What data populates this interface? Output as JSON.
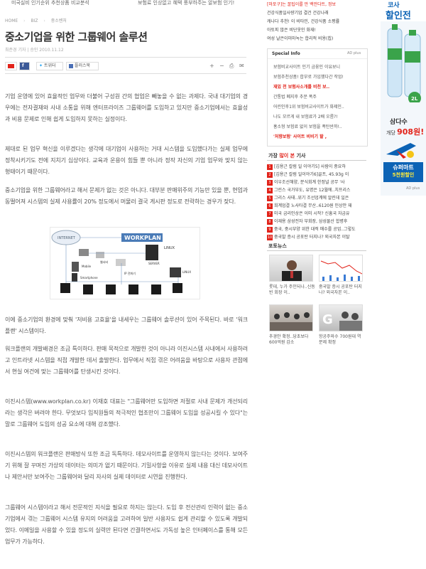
{
  "top_strip": {
    "left": "미국실비 인기순위 추천상품 비교분석",
    "right": "보험료 인상없고 혜택 풍부하주는 알보험 인기!"
  },
  "breadcrumb": [
    "HOME",
    "BIZ",
    "중소벤처"
  ],
  "article": {
    "title": "중소기업을 위한 그룹웨어 솔루션",
    "byline": "최준경 기자  |  승인 2010.11.12",
    "share": {
      "facebook": "",
      "twitter": "트위터",
      "story": "플러스북"
    },
    "controls": [
      "+",
      "−",
      "⎙",
      "✉"
    ],
    "paragraphs": [
      "기업 운영에 있어 효율적인 업무와 더불어 구성원 간의 협업은 빼놓을 수 없는 과제다. 국내 대기업의 경우에는 전자결재와 사내 소통을 위해 엔터프라이즈 그룹웨어를 도입하고 있지만 중소기업에서는 효율성과 비용 문제로 인해 쉽게 도입하지 못하는 실정이다.",
      "제대로 된 업무 혁신을 이루겠다는 생각에 대기업이 사용하는 거대 시스템을 도입했다가는 실제 업무에 정착시키기도 전에 지치기 십상이다. 교육과 운용이 힘들 뿐 아니라 정작 자신의 기업 업무와 맞지 않는 형태이기 때문이다.",
      "중소기업을 위한 그룹웨어라고 해서 문제가 없는 것은 아니다. 대부분 판매위주의 기능만 있을 뿐, 현업과 동떨어져 시스템의 실제 사용률이 20% 정도에서 머물러 결국 게시판 정도로 전락하는 경우가 잦다.",
      "이에 중소기업의 환경에 맞춰 '저비용 고효율'을 내세우는 그룹웨어 솔루션이 있어 주목된다. 바로 '워크플랜' 시스템이다.",
      "워크플랜의 개발배경은 조금 특이하다. 판매 목적으로 개발한 것이 아니라 이진시스템 사내에서 사용하려고 인트라넷 시스템을 직접 개발한 데서 출발한다. 업무에서 직접 겪은 어려움을 바탕으로 사용자 관점에서 현실 여건에 맞는 그룹웨어를 탄생시킨 것이다.",
      "이진시스템(www.workplan.co.kr) 이재호 대표는 \"그룹웨어만 도입하면 저절로 사내 문제가 개선되리라는 생각은 버려야 한다. 무엇보다 임직원들의 적극적인 협조만이 그룹웨어 도입을 성공시킬 수 있다\"는 말로 그룹웨어 도입의 성공 요소에 대해 강조했다.",
      "이진시스템의 워크플랜은 판매방식 또한 조금 독특하다. 데모사이트를 운영하지 않는다는 것이다. 보여주기 위해 잘 꾸며진 가상의 데이터는 의미가 없기 때문이다. 기밀사항을 이유로 실제 내용 대신 데모사이트나 제안서만 보여주는 그룹웨어와 달리 자사의 실제 데이터로 시연을 진행한다.",
      "그룹웨어 시스템이라고 해서 전문적인 지식을 필요로 하지는 않는다. 도입 후 전산관리 인력이 없는 중소기업에서 겪는 그룹웨어 시스템 유지의 어려움을 고려하여 일반 사용자도 쉽게 관리할 수 있도록 개발되었다. 이메일을 사용할 수 있을 정도의 실력만 된다면 간결하면서도 가독성 높은 인터페이스를 통해 모든 업무가 가능하다."
    ],
    "figure": {
      "brand": "WORKPLAN",
      "labels": [
        "INTERNET",
        "LINUX",
        "SERVER",
        "Mobile",
        "Smartphone",
        "웹서버",
        "IP 전화기",
        "LINUX"
      ]
    }
  },
  "right_column": {
    "top_links": [
      "[마포구]는 꿀팁이를 만 백만다트, 정보",
      "건강식품일사량기업 결건 건강나래",
      "캐나다 추천! 이 비타민, 건강식품 소평률",
      "아토피 많은 비단옷인 화재!",
      "여성 날은이미마녹는 합리적 비용(칩)"
    ],
    "special": {
      "header": "Special Info",
      "ad_label": "AD plus",
      "items": [
        "보험비교사이트 인기 금융인 이유보니",
        "보험추천상품! 합부로 가입했다간 작업!",
        "재밌 천 보험사소개를 비천 보..",
        "간통법 폐지후 추문 폭주",
        "어린인후1위 보험비교사이트가 화제인..",
        "나도 모르게 내 보험료가 2배 오름?!",
        "홍소형 보험료 없이 보험을 폭탄싼까!..",
        "'처향보험' 사이트 비비기 할 ,"
      ]
    },
    "popular": {
      "header_a": "가장",
      "header_b": "많이 본",
      "header_c": "기사",
      "items": [
        "[김용근 칼럼 일 이야기5] 사람이 중요하",
        "[김용근 칼럼 일이야기6]골프, 45.93g 이",
        "이우조선해양, 분식회계 한정널 공무 '사",
        "그린스 국가부도, 유명은 12월에..치프리스",
        "그리스 사태..위기 조선업계에 알린데 일은",
        "희계업결 노사타결 무산..6120원 인상안 재",
        "미국 금리인상은 이미 시작? 신흥국 자금유",
        "이재용 삼성전자 부회장, 삼성물산 합병후",
        "중국, 중시부양 위한 대적 매수를 공업..그렇도",
        "중국발 증시 공포탄 터지나? 외국자본 이탈"
      ]
    },
    "photo_news": {
      "header": "포토뉴스",
      "captions": [
        "롯데, 누가 주인되나..신동빈 회장 이..",
        "중국발 증시 공포탄 터지나? 외국자본 이..",
        "추경안 확정..당초보다 600억원 감소",
        "항공주와수 700원대 역 분제 확정"
      ]
    }
  },
  "side_ad": {
    "brand_top": "코사",
    "line1": "할인전",
    "water": "삼다수",
    "sale_prefix": "개당",
    "price": "908원!",
    "store": "슈퍼마트",
    "coupon": "5천원할인",
    "ad_label": "AD plus",
    "colors": {
      "brand": "#0c63b5",
      "accent": "#e2231a",
      "green": "#3aa34a"
    }
  }
}
